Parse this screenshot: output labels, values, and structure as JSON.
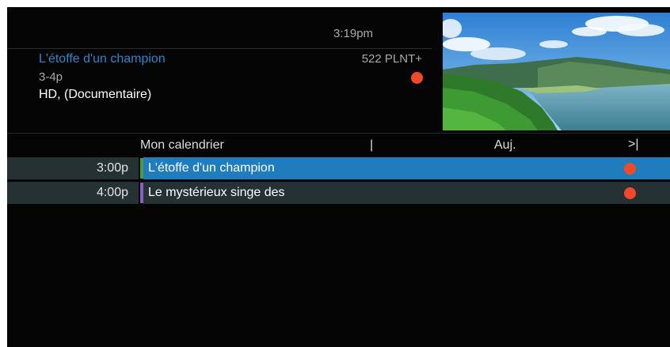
{
  "info": {
    "clock": "3:19pm",
    "title": "L'étoffe d'un champion",
    "channel": "522 PLNT+",
    "time_range": "3-4p",
    "meta": "HD, (Documentaire)"
  },
  "calendar": {
    "title": "Mon calendrier",
    "separator": "|",
    "day": "Auj.",
    "next": ">|"
  },
  "rows": [
    {
      "time": "3:00p",
      "title": "L'étoffe d'un champion",
      "recording": true,
      "selected": true,
      "accent": "#4f9a3f"
    },
    {
      "time": "4:00p",
      "title": "Le mystérieux singe des",
      "recording": true,
      "selected": false,
      "accent": "#8b5cc4"
    }
  ],
  "colors": {
    "record": "#f14a2b",
    "selected_row": "#1f7dbd",
    "row": "#263134",
    "title_accent": "#2f86c6"
  },
  "icons": {
    "record": "record-dot-icon",
    "next": "skip-next-icon"
  }
}
